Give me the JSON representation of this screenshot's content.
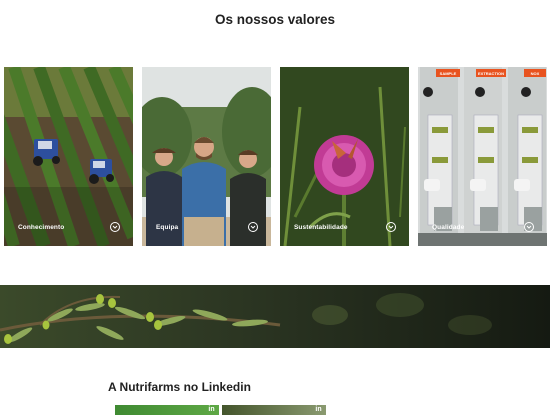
{
  "values_section": {
    "title": "Os nossos valores",
    "cards": [
      {
        "label": "Conhecimento",
        "icon": "chevron-down-icon"
      },
      {
        "label": "Equipa",
        "icon": "chevron-down-icon"
      },
      {
        "label": "Sustentabilidade",
        "icon": "chevron-down-icon"
      },
      {
        "label": "Qualidade",
        "icon": "chevron-down-icon"
      }
    ]
  },
  "lab_signs": [
    "SAMPLE",
    "EXTRACTION",
    "NOX"
  ],
  "linkedin_section": {
    "title": "A Nutrifarms no Linkedin",
    "badge": "in"
  },
  "colors": {
    "accent_orange": "#e8531f",
    "linkedin_green": "#4f9a3a",
    "text_dark": "#222222"
  }
}
